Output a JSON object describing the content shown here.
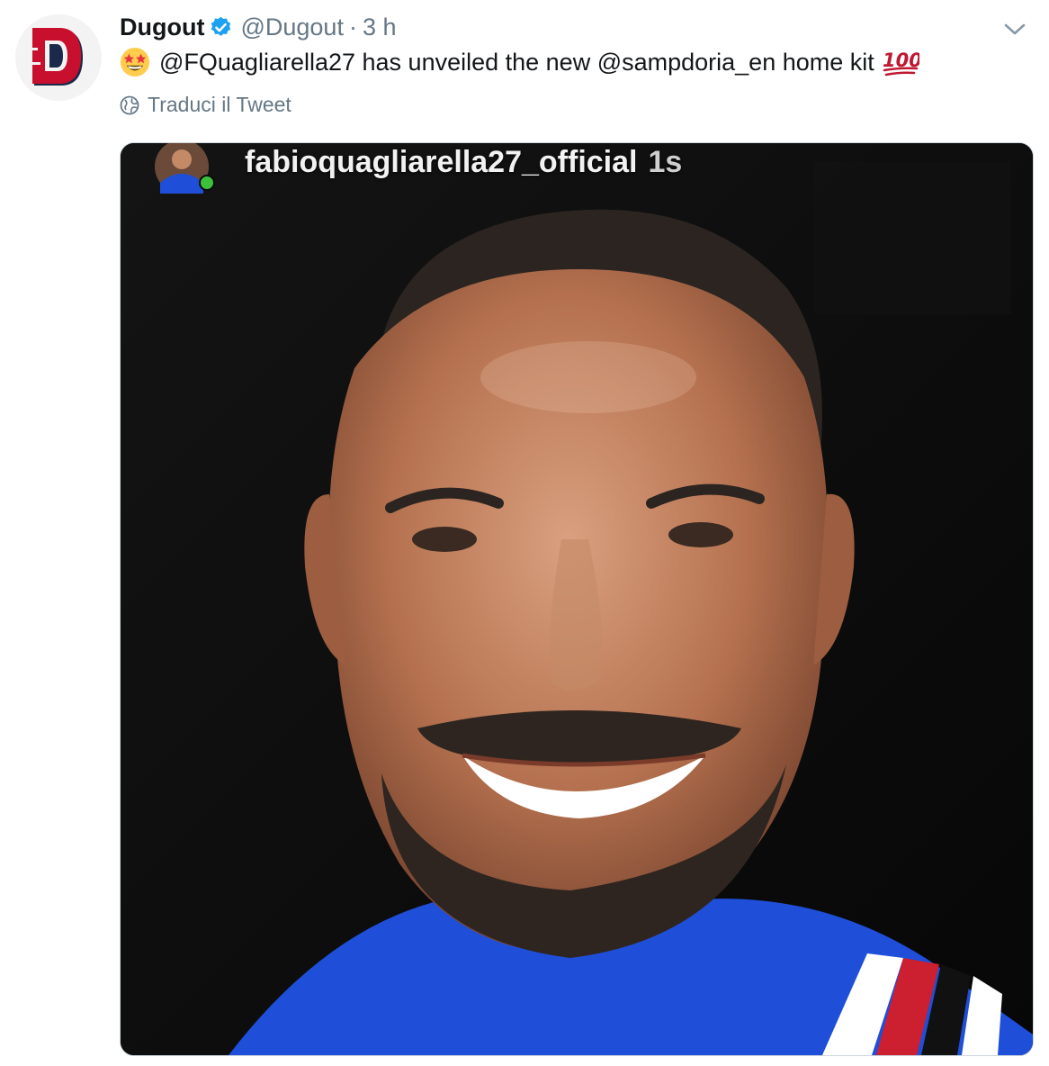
{
  "tweet": {
    "author": {
      "display_name": "Dugout",
      "handle": "@Dugout",
      "avatar_icon": "dugout-logo-icon",
      "verified": true
    },
    "separator": "·",
    "time": "3 h",
    "text": "@FQuagliarella27 has unveiled the new @sampdoria_en home kit",
    "emoji_start": "star-struck-emoji",
    "emoji_end": "hundred-points-emoji",
    "translate_label": "Traduci il Tweet",
    "media": {
      "story_username": "fabioquagliarella27_official",
      "story_time": "1s"
    }
  },
  "colors": {
    "verified": "#1da1f2",
    "secondary_text": "#657786",
    "logo_red": "#c8102e",
    "logo_navy": "#1b2a4a",
    "kit_blue": "#1f4fd8"
  }
}
